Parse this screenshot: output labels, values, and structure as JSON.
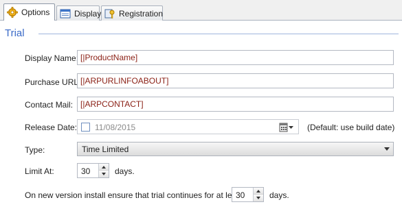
{
  "tabs": [
    {
      "label": "Options",
      "icon": "gear-icon",
      "active": true
    },
    {
      "label": "Display",
      "icon": "display-window-icon",
      "active": false
    },
    {
      "label": "Registration",
      "icon": "registration-key-icon",
      "active": false
    }
  ],
  "section": {
    "title": "Trial"
  },
  "fields": {
    "display_name": {
      "label": "Display Name:",
      "value": "[|ProductName]"
    },
    "purchase_url": {
      "label": "Purchase URL:",
      "value": "[|ARPURLINFOABOUT]"
    },
    "contact_mail": {
      "label": "Contact Mail:",
      "value": "[|ARPCONTACT]"
    },
    "release_date": {
      "label": "Release Date:",
      "value": "11/08/2015",
      "checked": false,
      "note": "(Default: use build date)"
    },
    "type": {
      "label": "Type:",
      "value": "Time Limited"
    },
    "limit_at": {
      "label": "Limit At:",
      "value": "30",
      "suffix": "days."
    },
    "new_version": {
      "label": "On new version install ensure that trial continues for at least",
      "value": "30",
      "suffix": "days."
    }
  },
  "colors": {
    "accent": "#3a6ac7",
    "value_text": "#8a1f14"
  }
}
